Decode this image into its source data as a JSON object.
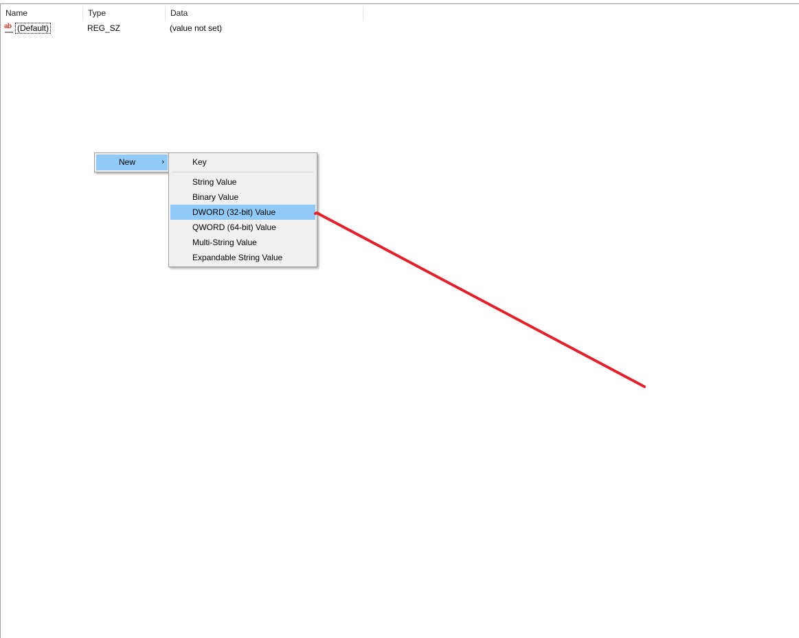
{
  "list": {
    "columns": [
      "Name",
      "Type",
      "Data"
    ],
    "rows": [
      {
        "icon": "string-value-icon",
        "icon_text": "ab",
        "name": "(Default)",
        "type": "REG_SZ",
        "data": "(value not set)"
      }
    ]
  },
  "context_menu": {
    "new_label": "New",
    "new_arrow": "›"
  },
  "submenu": {
    "key": "Key",
    "string_value": "String Value",
    "binary_value": "Binary Value",
    "dword_value": "DWORD (32-bit) Value",
    "qword_value": "QWORD (64-bit) Value",
    "multi_string_value": "Multi-String Value",
    "expandable_string_value": "Expandable String Value"
  },
  "colors": {
    "highlight": "#91c9f7",
    "menu_background": "#f0f0f0",
    "annotation": "#e0202a"
  }
}
